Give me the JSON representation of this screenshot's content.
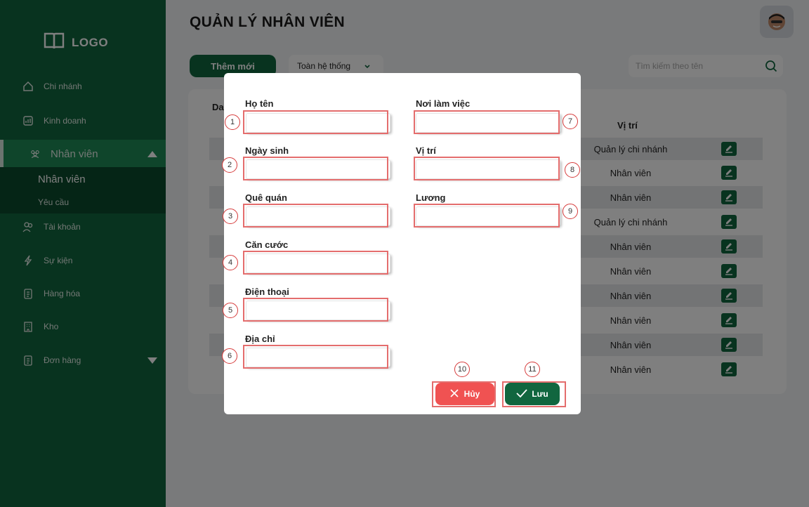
{
  "sidebar": {
    "logo_text": "LOGO",
    "items": [
      {
        "label": "Chi nhánh",
        "icon": "home-icon"
      },
      {
        "label": "Kinh doanh",
        "icon": "chart-icon"
      },
      {
        "label": "Nhân viên",
        "icon": "users-icon"
      },
      {
        "label": "Tài khoản",
        "icon": "account-icon"
      },
      {
        "label": "Sự kiện",
        "icon": "lightning-icon"
      },
      {
        "label": "Hàng hóa",
        "icon": "clipboard-icon"
      },
      {
        "label": "Kho",
        "icon": "building-icon"
      },
      {
        "label": "Đơn hàng",
        "icon": "clipboard-icon"
      }
    ],
    "sub_items": [
      {
        "label": "Nhân viên"
      },
      {
        "label": "Yêu cầu"
      }
    ]
  },
  "header": {
    "title": "QUẢN LÝ NHÂN VIÊN",
    "add_label": "Thêm mới",
    "scope_select": "Toàn hệ thống",
    "search_placeholder": "Tìm kiếm theo tên"
  },
  "table": {
    "title_fragment": "Da",
    "column_header": "Vị trí",
    "rows": [
      {
        "position": "Quản lý chi nhánh"
      },
      {
        "position": "Nhân viên"
      },
      {
        "position": "Nhân viên"
      },
      {
        "position": "Quản lý chi nhánh"
      },
      {
        "position": "Nhân viên"
      },
      {
        "position": "Nhân viên"
      },
      {
        "position": "Nhân viên"
      },
      {
        "position": "Nhân viên"
      },
      {
        "position": "Nhân viên"
      },
      {
        "position": "Nhân viên"
      }
    ]
  },
  "modal": {
    "fields": [
      {
        "label": "Họ tên",
        "badge": "1",
        "value": ""
      },
      {
        "label": "Ngày sinh",
        "badge": "2",
        "value": ""
      },
      {
        "label": "Quê quán",
        "badge": "3",
        "value": ""
      },
      {
        "label": "Căn cước",
        "badge": "4",
        "value": ""
      },
      {
        "label": "Điện thoại",
        "badge": "5",
        "value": ""
      },
      {
        "label": "Địa chỉ",
        "badge": "6",
        "value": ""
      },
      {
        "label": "Nơi làm việc",
        "badge": "7",
        "value": ""
      },
      {
        "label": "Vị trí",
        "badge": "8",
        "value": ""
      },
      {
        "label": "Lương",
        "badge": "9",
        "value": ""
      }
    ],
    "cancel_label": "Hủy",
    "cancel_badge": "10",
    "save_label": "Lưu",
    "save_badge": "11"
  },
  "colors": {
    "brand_green": "#11663f",
    "active_green": "#1f8a57",
    "danger_red": "#f05252",
    "annotation_red": "#e46d6d"
  }
}
